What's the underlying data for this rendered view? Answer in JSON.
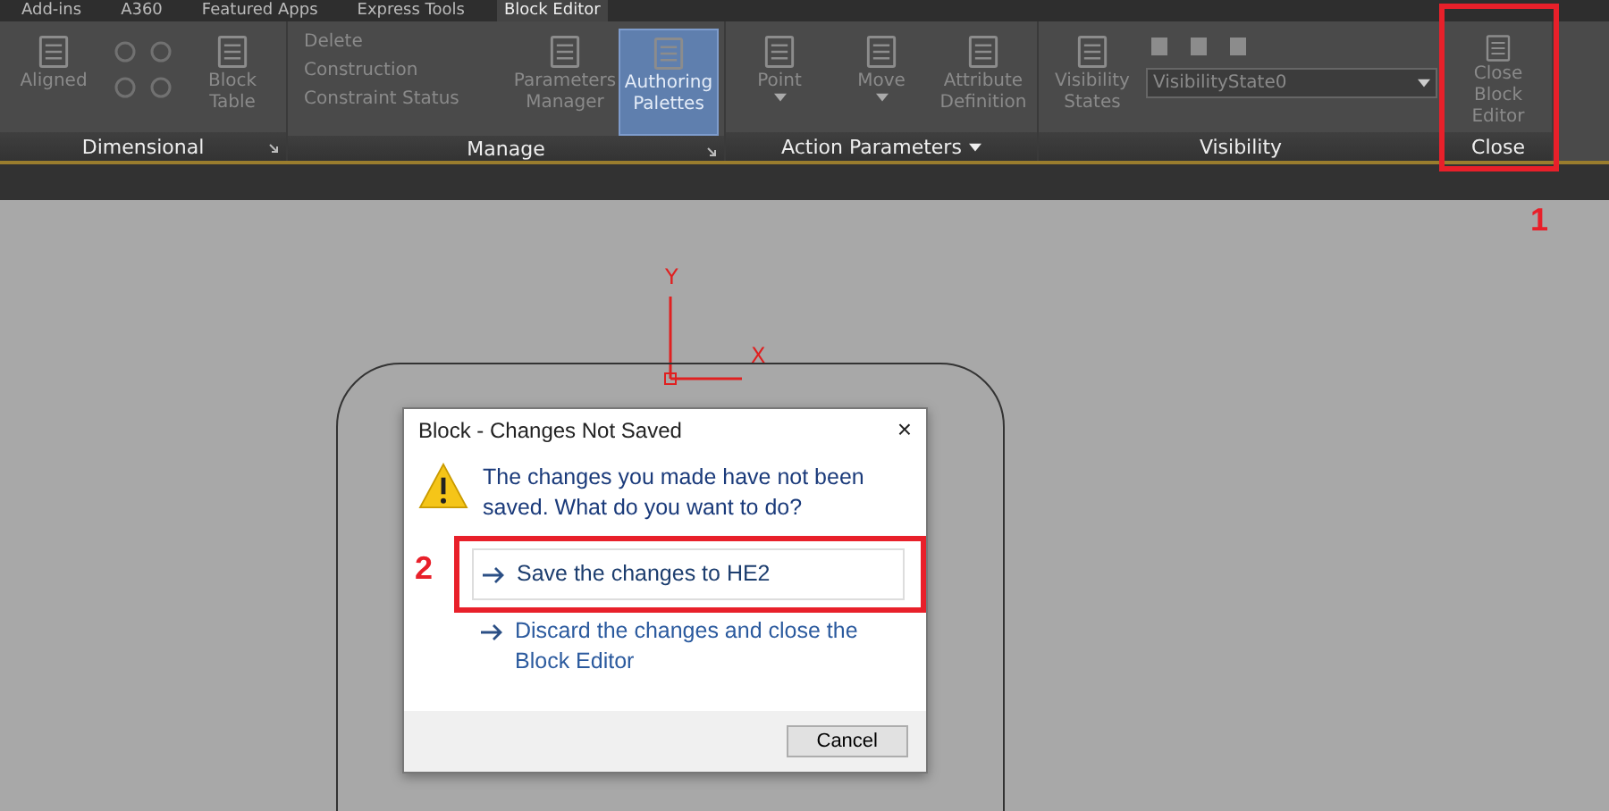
{
  "ribbon_tabs": [
    {
      "label": "Add-ins",
      "selected": false
    },
    {
      "label": "A360",
      "selected": false
    },
    {
      "label": "Featured Apps",
      "selected": false
    },
    {
      "label": "Express Tools",
      "selected": false
    },
    {
      "label": "Block Editor",
      "selected": true
    }
  ],
  "ribbon_panels": [
    {
      "title": "Dimensional",
      "launcher": true,
      "title_dropdown": false,
      "tools": [
        {
          "kind": "large",
          "label": "Aligned",
          "disabled": true,
          "active": false,
          "dropdown": false
        },
        {
          "kind": "icons",
          "disabled": true
        },
        {
          "kind": "large",
          "label": "Block Table",
          "disabled": true,
          "active": false,
          "dropdown": false
        }
      ]
    },
    {
      "title": "Manage",
      "launcher": true,
      "title_dropdown": false,
      "tools": [
        {
          "kind": "stack",
          "items": [
            "Delete",
            "Construction",
            "Constraint Status"
          ],
          "disabled": true
        },
        {
          "kind": "large",
          "label": "Parameters Manager",
          "disabled": true,
          "active": false,
          "dropdown": false
        },
        {
          "kind": "large",
          "label": "Authoring Palettes",
          "disabled": true,
          "active": true,
          "dropdown": false
        }
      ]
    },
    {
      "title": "Action Parameters",
      "launcher": false,
      "title_dropdown": true,
      "tools": [
        {
          "kind": "large",
          "label": "Point",
          "disabled": true,
          "active": false,
          "dropdown": true
        },
        {
          "kind": "large",
          "label": "Move",
          "disabled": true,
          "active": false,
          "dropdown": true
        },
        {
          "kind": "large",
          "label": "Attribute Definition",
          "disabled": true,
          "active": false,
          "dropdown": false
        }
      ]
    },
    {
      "title": "Visibility",
      "launcher": false,
      "title_dropdown": false,
      "tools": [
        {
          "kind": "large",
          "label": "Visibility States",
          "disabled": true,
          "active": false,
          "dropdown": false
        },
        {
          "kind": "combo",
          "label": "VisibilityState0",
          "disabled": true
        }
      ]
    },
    {
      "title": "Close",
      "launcher": false,
      "title_dropdown": false,
      "annotation": "1",
      "tools": [
        {
          "kind": "large",
          "label": "Close Block Editor",
          "disabled": true,
          "active": false,
          "dropdown": false
        }
      ]
    }
  ],
  "canvas": {
    "ucs": {
      "x_label": "X",
      "y_label": "Y"
    }
  },
  "dialog": {
    "title": "Block - Changes Not Saved",
    "close": "×",
    "message": "The changes you made have not been saved. What do you want to do?",
    "options": [
      {
        "label": "Save the changes to HE2",
        "highlighted": true,
        "annotation": "2"
      },
      {
        "label": "Discard the changes and close the Block Editor",
        "highlighted": false
      }
    ],
    "cancel": "Cancel"
  }
}
